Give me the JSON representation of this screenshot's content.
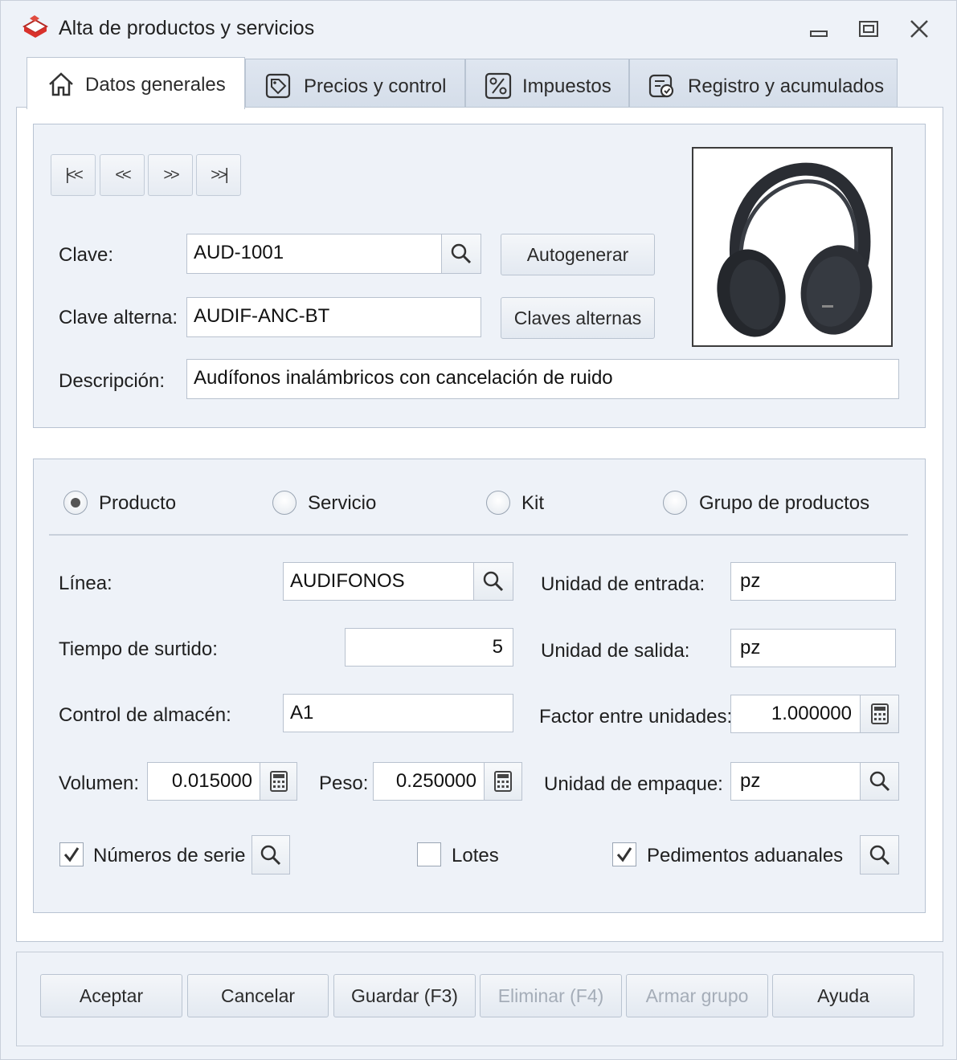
{
  "window": {
    "title": "Alta de productos y servicios"
  },
  "tabs": [
    {
      "label": "Datos generales",
      "icon": "home-icon",
      "active": true
    },
    {
      "label": "Precios y control",
      "icon": "price-tag-icon",
      "active": false
    },
    {
      "label": "Impuestos",
      "icon": "percent-icon",
      "active": false
    },
    {
      "label": "Registro y acumulados",
      "icon": "register-icon",
      "active": false
    }
  ],
  "navigation": {
    "first": "first-record-icon",
    "previous": "previous-record-icon",
    "next": "next-record-icon",
    "last": "last-record-icon"
  },
  "general": {
    "clave_label": "Clave:",
    "clave_value": "AUD-1001",
    "autogenerar_label": "Autogenerar",
    "clave_alterna_label": "Clave alterna:",
    "clave_alterna_value": "AUDIF-ANC-BT",
    "claves_alternas_label": "Claves alternas",
    "descripcion_label": "Descripción:",
    "descripcion_value": "Audífonos inalámbricos con cancelación de ruido",
    "photo": "headphones-image"
  },
  "type": {
    "options": [
      {
        "label": "Producto",
        "selected": true
      },
      {
        "label": "Servicio",
        "selected": false
      },
      {
        "label": "Kit",
        "selected": false
      },
      {
        "label": "Grupo de productos",
        "selected": false
      }
    ]
  },
  "details": {
    "linea_label": "Línea:",
    "linea_value": "AUDIFONOS",
    "tiempo_label": "Tiempo de surtido:",
    "tiempo_value": "5",
    "control_label": "Control de almacén:",
    "control_value": "A1",
    "volumen_label": "Volumen:",
    "volumen_value": "0.015000",
    "peso_label": "Peso:",
    "peso_value": "0.250000",
    "unidad_entrada_label": "Unidad de entrada:",
    "unidad_entrada_value": "pz",
    "unidad_salida_label": "Unidad de salida:",
    "unidad_salida_value": "pz",
    "factor_label": "Factor entre unidades:",
    "factor_value": "1.000000",
    "unidad_empaque_label": "Unidad de empaque:",
    "unidad_empaque_value": "pz",
    "numeros_serie_label": "Números de serie",
    "numeros_serie_checked": true,
    "lotes_label": "Lotes",
    "lotes_checked": false,
    "pedimentos_label": "Pedimentos aduanales",
    "pedimentos_checked": true
  },
  "footer": {
    "aceptar": "Aceptar",
    "cancelar": "Cancelar",
    "guardar": "Guardar (F3)",
    "eliminar": "Eliminar (F4)",
    "armar_grupo": "Armar grupo",
    "ayuda": "Ayuda"
  },
  "colors": {
    "window_bg": "#eef2f8",
    "disabled_text": "#a5adb8",
    "app_icon_red": "#d9322c"
  }
}
